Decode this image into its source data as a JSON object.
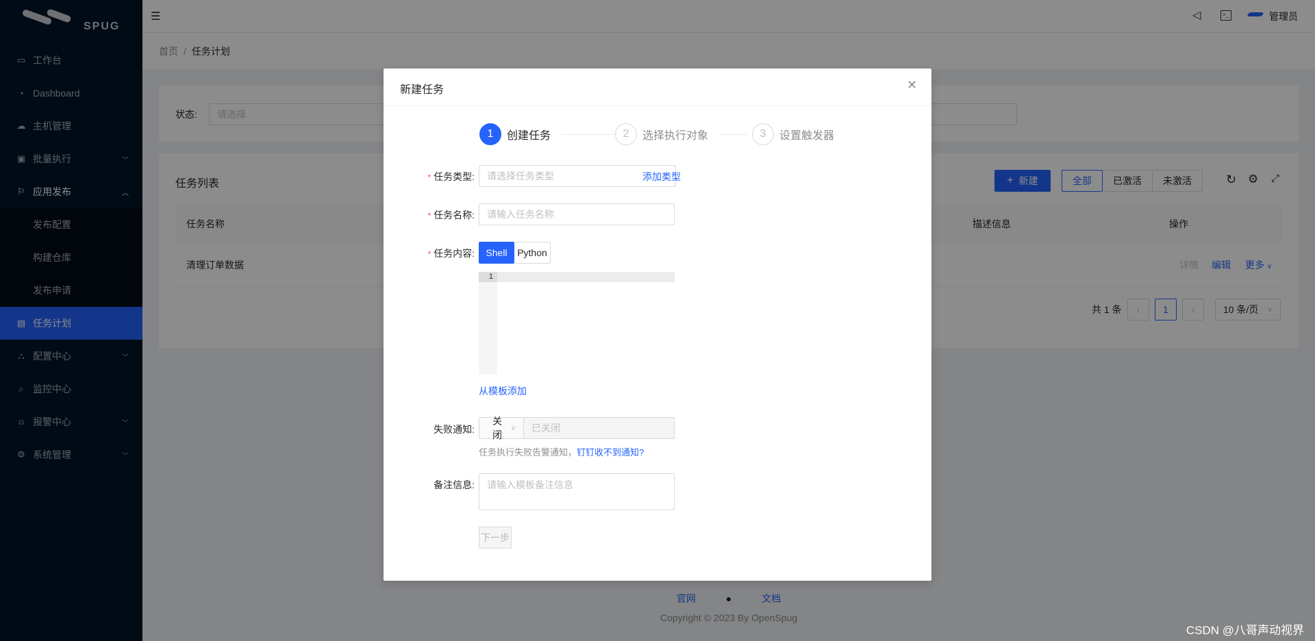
{
  "sidebar": {
    "logo_text": "SPUG",
    "items": [
      {
        "label": "工作台",
        "icon": "desktop-icon"
      },
      {
        "label": "Dashboard",
        "icon": "dashboard-icon"
      },
      {
        "label": "主机管理",
        "icon": "cloud-server-icon"
      },
      {
        "label": "批量执行",
        "icon": "code-icon",
        "chevron": "down"
      },
      {
        "label": "应用发布",
        "icon": "flag-icon",
        "chevron": "up"
      },
      {
        "label": "发布配置",
        "sub": true
      },
      {
        "label": "构建仓库",
        "sub": true
      },
      {
        "label": "发布申请",
        "sub": true
      },
      {
        "label": "任务计划",
        "icon": "schedule-icon",
        "selected": true
      },
      {
        "label": "配置中心",
        "icon": "cluster-icon",
        "chevron": "down"
      },
      {
        "label": "监控中心",
        "icon": "monitor-icon"
      },
      {
        "label": "报警中心",
        "icon": "alert-icon",
        "chevron": "down"
      },
      {
        "label": "系统管理",
        "icon": "setting-icon",
        "chevron": "down"
      }
    ]
  },
  "header": {
    "user": "管理员"
  },
  "breadcrumb": {
    "home": "首页",
    "sep": "/",
    "current": "任务计划"
  },
  "filter": {
    "label": "状态:",
    "placeholder": "请选择"
  },
  "table": {
    "title": "任务列表",
    "new_button": "新建",
    "radio": [
      "全部",
      "已激活",
      "未激活"
    ],
    "radio_selected": "全部",
    "columns": [
      "任务名称",
      "描述信息",
      "操作"
    ],
    "rows": [
      {
        "name": "清理订单数据",
        "actions": [
          "详情",
          "编辑",
          "更多"
        ]
      }
    ],
    "pagination": {
      "total": "共 1 条",
      "page": "1",
      "page_size": "10 条/页"
    }
  },
  "footer": {
    "links": [
      "官网",
      "文档"
    ],
    "copyright": "Copyright © 2023 By OpenSpug"
  },
  "watermark": "CSDN @八哥声动视界",
  "modal": {
    "title": "新建任务",
    "steps": [
      {
        "n": "1",
        "label": "创建任务"
      },
      {
        "n": "2",
        "label": "选择执行对象"
      },
      {
        "n": "3",
        "label": "设置触发器"
      }
    ],
    "type_label": "任务类型:",
    "type_placeholder": "请选择任务类型",
    "add_type": "添加类型",
    "name_label": "任务名称:",
    "name_placeholder": "请输入任务名称",
    "content_label": "任务内容:",
    "lang_tabs": [
      "Shell",
      "Python"
    ],
    "lang_selected": "Shell",
    "editor_line": "1",
    "from_template": "从模板添加",
    "notify_label": "失败通知:",
    "notify_select": "关闭",
    "notify_input": "已关闭",
    "notify_help": "任务执行失败告警通知，",
    "notify_help_link": "钉钉收不到通知?",
    "remark_label": "备注信息:",
    "remark_placeholder": "请输入模板备注信息",
    "next_button": "下一步"
  },
  "colors": {
    "primary": "#2563fc",
    "sidebar": "#001529",
    "required": "#ff4d4f"
  }
}
